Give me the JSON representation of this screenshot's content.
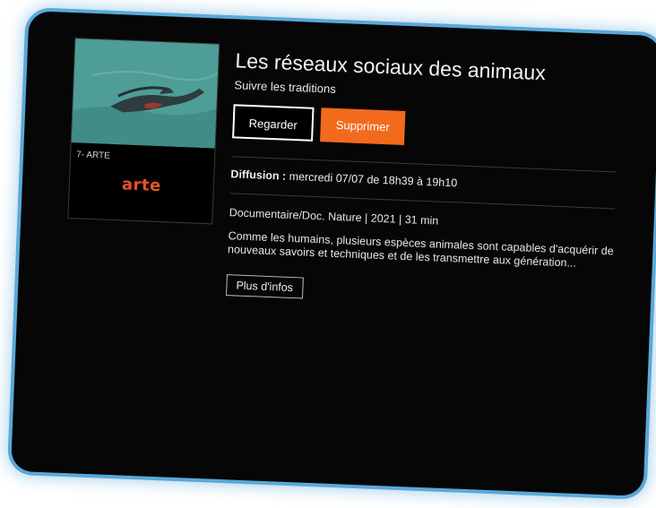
{
  "channel": {
    "number_name": "7- ARTE",
    "logo_text": "arte",
    "logo_color": "#e5522a"
  },
  "program": {
    "title": "Les réseaux sociaux des animaux",
    "subtitle": "Suivre les traditions",
    "broadcast_label": "Diffusion :",
    "broadcast_value": "mercredi 07/07 de 18h39 à 19h10",
    "meta": "Documentaire/Doc. Nature | 2021 | 31 min",
    "description": "Comme les humains, plusieurs espèces animales sont capables d'acquérir de nouveaux savoirs et techniques et de les transmettre aux génération..."
  },
  "actions": {
    "watch_label": "Regarder",
    "delete_label": "Supprimer",
    "more_label": "Plus d'infos",
    "delete_color": "#f26a1b"
  },
  "frame": {
    "accent_color": "#5aa8d8"
  }
}
